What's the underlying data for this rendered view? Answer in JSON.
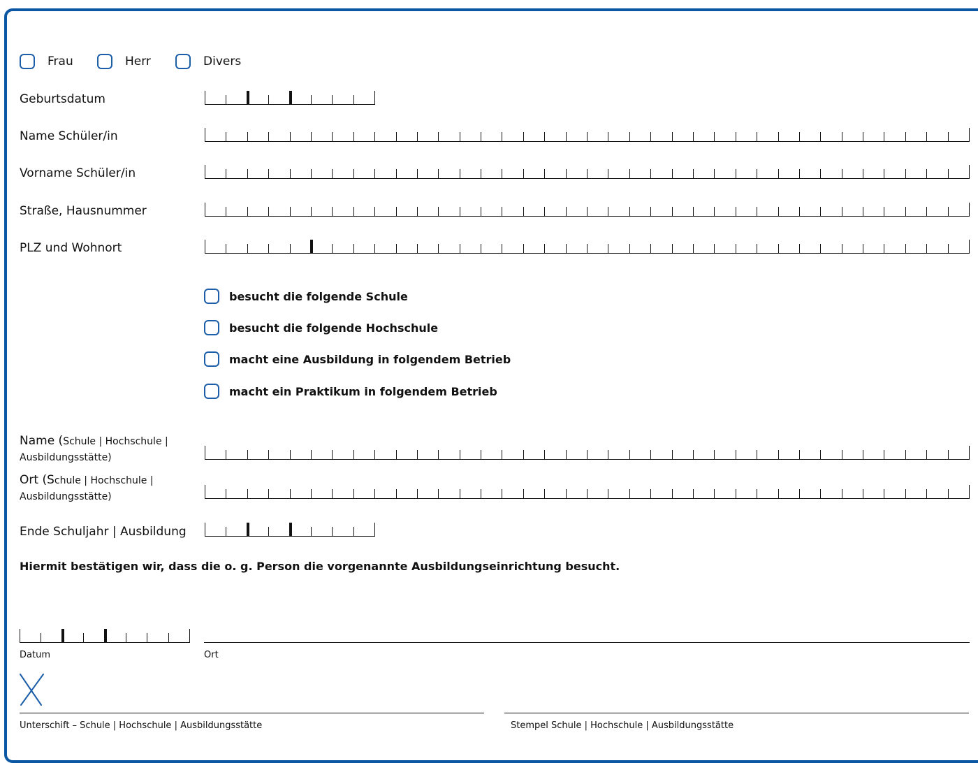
{
  "salutation": {
    "options": [
      "Frau",
      "Herr",
      "Divers"
    ]
  },
  "fields": {
    "birthdate": "Geburtsdatum",
    "last_name": "Name Schüler/in",
    "first_name": "Vorname Schüler/in",
    "street": "Straße, Hausnummer",
    "zip_city": "PLZ und Wohnort"
  },
  "status_options": [
    "besucht die folgende Schule",
    "besucht die folgende Hochschule",
    "macht eine Ausbildung in folgendem Betrieb",
    "macht ein Praktikum in folgendem Betrieb"
  ],
  "institution": {
    "name_main": "Name (",
    "name_small": "Schule | Hochschule | Ausbildungsstätte)",
    "place_main": "Ort (S",
    "place_small": "chule | Hochschule | Ausbildungsstätte)",
    "end_label": "Ende Schuljahr | Ausbildung"
  },
  "confirmation": "Hiermit bestätigen wir, dass die o. g. Person die vorgenannte Ausbildungseinrichtung besucht.",
  "signature": {
    "date_label": "Datum",
    "place_label": "Ort",
    "sign_mark": "X",
    "signature_label": "Unterschift – Schule | Hochschule | Ausbildungsstätte",
    "stamp_label": "Stempel Schule | Hochschule | Ausbildungsstätte"
  },
  "colors": {
    "frame": "#0b57a4",
    "checkbox": "#1c5ea8",
    "sign_mark": "#1c5ea8"
  }
}
